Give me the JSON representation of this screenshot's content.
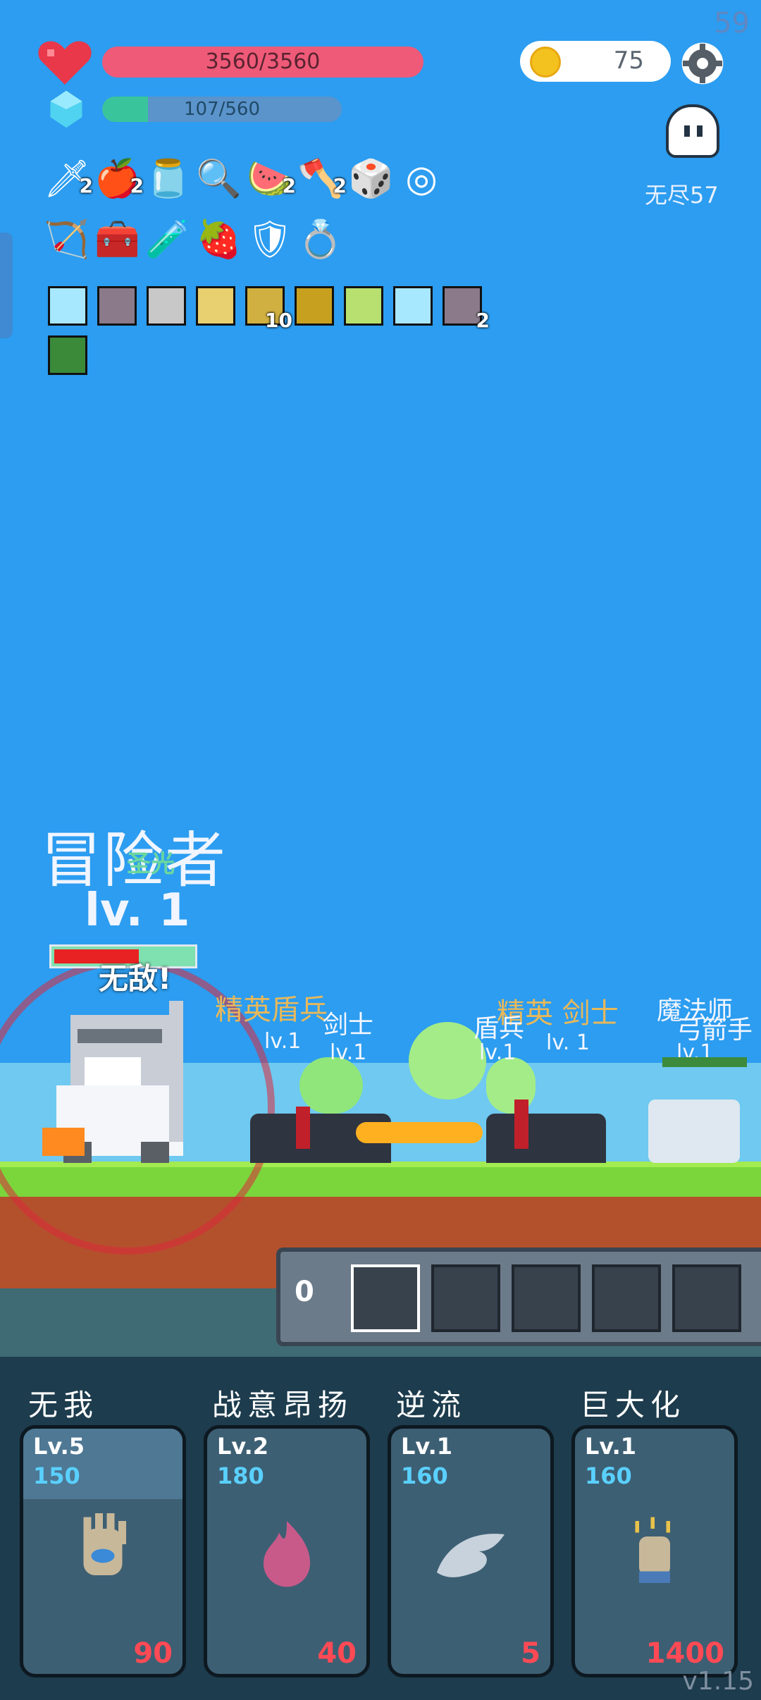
{
  "hud": {
    "fps": "59",
    "hp_text": "3560/3560",
    "mp_text": "107/560",
    "mp_fraction": 0.19,
    "coins": "75",
    "mode_label": "无尽57",
    "version": "v1.15"
  },
  "items_row1": [
    {
      "name": "sword-icon",
      "glyph": "🗡",
      "count": "2"
    },
    {
      "name": "apple-icon",
      "glyph": "🍎",
      "count": "2"
    },
    {
      "name": "jam-jar-icon",
      "glyph": "🫙",
      "count": ""
    },
    {
      "name": "magnifier-icon",
      "glyph": "🔍",
      "count": ""
    },
    {
      "name": "watermelon-icon",
      "glyph": "🍉",
      "count": "2"
    },
    {
      "name": "axe-icon",
      "glyph": "🪓",
      "count": "2"
    },
    {
      "name": "dice-icon",
      "glyph": "🎲",
      "count": ""
    },
    {
      "name": "ring-orbit-icon",
      "glyph": "◎",
      "count": ""
    }
  ],
  "items_row2": [
    {
      "name": "bow-icon",
      "glyph": "🏹",
      "count": ""
    },
    {
      "name": "treasure-box-icon",
      "glyph": "🧰",
      "count": ""
    },
    {
      "name": "potion-icon",
      "glyph": "🧪",
      "count": ""
    },
    {
      "name": "strawberry-icon",
      "glyph": "🍓",
      "count": ""
    },
    {
      "name": "shield-icon",
      "glyph": "🛡",
      "count": ""
    },
    {
      "name": "gold-ring-icon",
      "glyph": "💍",
      "count": ""
    }
  ],
  "skill_icons": [
    {
      "name": "light-skill-icon",
      "color": "#a8e8ff",
      "count": ""
    },
    {
      "name": "blade-skill-icon",
      "color": "#8a7a8a",
      "count": ""
    },
    {
      "name": "armor-skill-icon",
      "color": "#c8c8c8",
      "count": ""
    },
    {
      "name": "aura-skill-icon",
      "color": "#e8d070",
      "count": ""
    },
    {
      "name": "arch-skill-icon",
      "color": "#d0b040",
      "count": "10"
    },
    {
      "name": "shadow-skill-icon",
      "color": "#c8a020",
      "count": ""
    },
    {
      "name": "sprout-skill-icon",
      "color": "#b8e070",
      "count": ""
    },
    {
      "name": "light2-skill-icon",
      "color": "#a8e8ff",
      "count": ""
    },
    {
      "name": "blade2-skill-icon",
      "color": "#8a7a8a",
      "count": "2"
    },
    {
      "name": "poison-skill-icon",
      "color": "#3a8a3a",
      "count": ""
    }
  ],
  "hero": {
    "name": "冒险者",
    "level": "lv. 1",
    "status": "无敌!",
    "buff": "圣光"
  },
  "enemies": {
    "label_a": "精英盾兵",
    "label_b": "剑士",
    "label_c": "lv.1",
    "label_d": "lv.1",
    "label_e": "精英 剑士",
    "label_f": "盾兵",
    "label_g": "lv.1",
    "label_h": "lv. 1",
    "label_i": "魔法师",
    "label_j": "弓箭手",
    "label_k": "lv.1"
  },
  "queue": {
    "count": "0"
  },
  "cards": [
    {
      "title": "无我",
      "level": "Lv.5",
      "cost": "150",
      "value": "90",
      "icon": "palm-eye-icon"
    },
    {
      "title": "战意昂扬",
      "level": "Lv.2",
      "cost": "180",
      "value": "40",
      "icon": "flame-icon"
    },
    {
      "title": "逆流",
      "level": "Lv.1",
      "cost": "160",
      "value": "5",
      "icon": "wing-icon"
    },
    {
      "title": "巨大化",
      "level": "Lv.1",
      "cost": "160",
      "value": "1400",
      "icon": "fist-icon"
    }
  ]
}
